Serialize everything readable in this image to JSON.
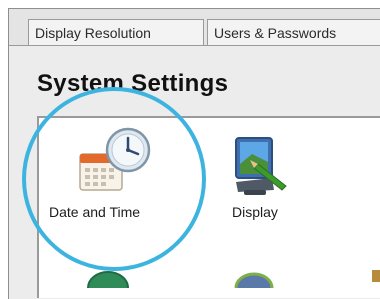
{
  "tabs": [
    {
      "label": "Display Resolution"
    },
    {
      "label": "Users & Passwords"
    }
  ],
  "page_title": "System Settings",
  "items": [
    {
      "label": "Date and Time",
      "icon": "calendar-clock-icon"
    },
    {
      "label": "Display",
      "icon": "monitor-icon"
    }
  ],
  "highlight_color": "#3db4e0"
}
